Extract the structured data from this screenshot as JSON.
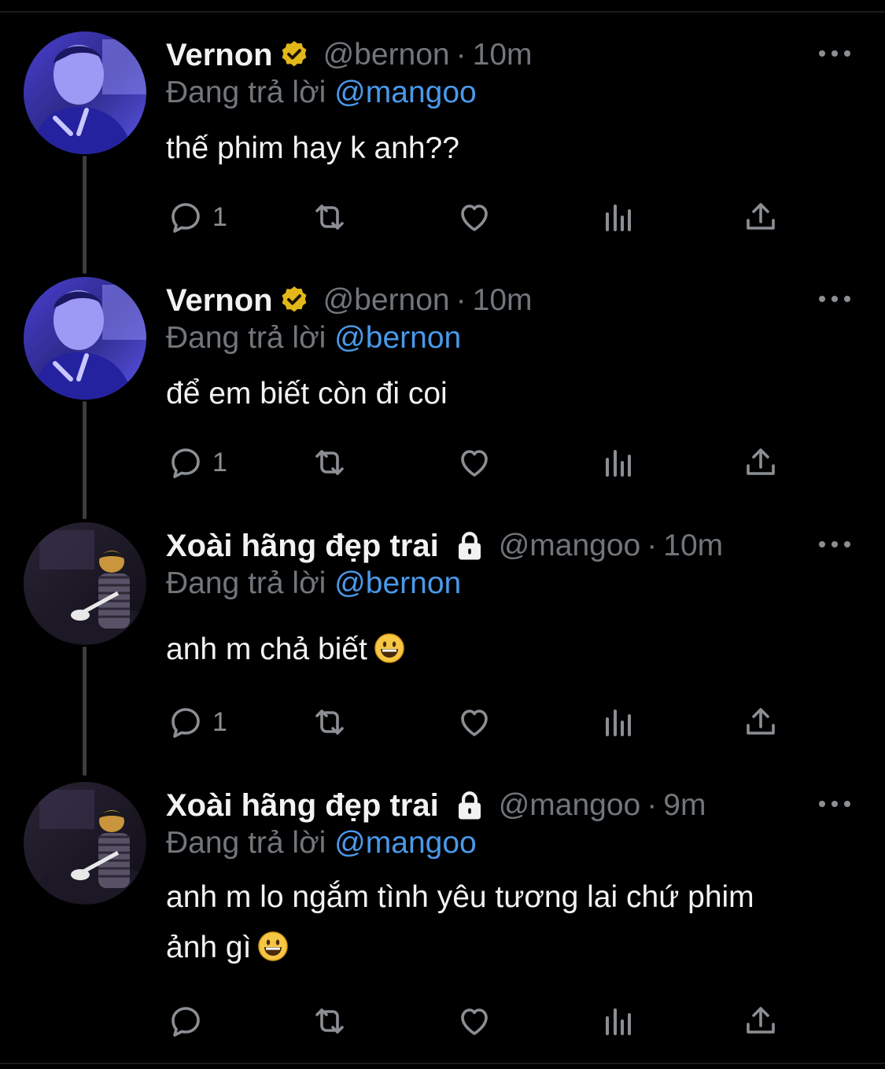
{
  "tweets": [
    {
      "name": "Vernon",
      "badge": "verified",
      "handle": "@bernon",
      "time": "10m",
      "reply_prefix": "Đang trả lời",
      "reply_to": "@mangoo",
      "text": "thế phim hay k anh??",
      "text2": "",
      "reply_count": "1"
    },
    {
      "name": "Vernon",
      "badge": "verified",
      "handle": "@bernon",
      "time": "10m",
      "reply_prefix": "Đang trả lời",
      "reply_to": "@bernon",
      "text": "để em biết còn đi coi",
      "text2": "",
      "reply_count": "1"
    },
    {
      "name": "Xoài hãng đẹp trai",
      "badge": "lock",
      "handle": "@mangoo",
      "time": "10m",
      "reply_prefix": "Đang trả lời",
      "reply_to": "@bernon",
      "text": "anh m chả biết",
      "text2": "",
      "reply_count": "1"
    },
    {
      "name": "Xoài hãng đẹp trai",
      "badge": "lock",
      "handle": "@mangoo",
      "time": "9m",
      "reply_prefix": "Đang trả lời",
      "reply_to": "@mangoo",
      "text": "anh m lo ngắm tình yêu tương lai chứ phim",
      "text2": "ảnh gì",
      "reply_count": ""
    }
  ],
  "separator": "·",
  "icons": [
    "verified-badge-icon",
    "lock-icon",
    "more-icon",
    "reply-icon",
    "retweet-icon",
    "like-icon",
    "analytics-icon",
    "share-icon",
    "smiley-emoji"
  ],
  "colors": {
    "background": "#000000",
    "mention": "#4a99e9",
    "muted": "#71767b",
    "verified": "#e2b719",
    "thread_line": "#3a3d41"
  }
}
